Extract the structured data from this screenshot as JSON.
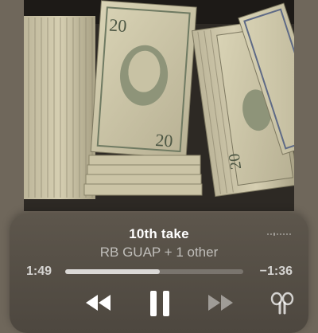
{
  "artwork": {
    "description": "stacks-of-twenty-dollar-bills",
    "bill_denomination_label": "20",
    "colors": {
      "bill": "#cfc8a8",
      "bill_dark": "#a9a283",
      "ink": "#3c4536",
      "background": "#2a2520"
    }
  },
  "now_playing": {
    "title": "10th take",
    "artist": "RB GUAP + 1 other",
    "elapsed": "1:49",
    "remaining": "−1:36",
    "progress": 0.53
  },
  "controls": {
    "rewind_icon": "rewind-icon",
    "pause_icon": "pause-icon",
    "forward_icon": "fast-forward-icon",
    "output_icon": "airpods-icon",
    "route_icon": "airplay-dots-icon"
  },
  "colors": {
    "card_bg": "#574f46",
    "page_bg": "#6f675b",
    "text_primary": "#ffffff",
    "text_secondary": "#b6b0a6"
  }
}
